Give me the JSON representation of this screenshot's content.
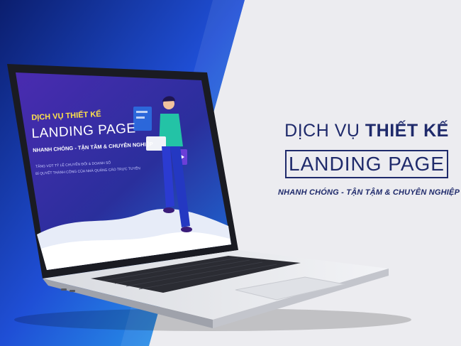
{
  "headline": {
    "line1_thin": "DỊCH VỤ ",
    "line1_bold": "THIẾT KẾ",
    "box_title": "LANDING PAGE",
    "subtitle": "NHANH CHÓNG - TẬN TẬM & CHUYÊN NGHIỆP"
  },
  "laptop_screen": {
    "line1": "DỊCH VỤ THIẾT KẾ",
    "line2": "LANDING PAGE",
    "line3": "NHANH CHÓNG - TẬN TÂM & CHUYÊN NGHIỆP",
    "line4": "TĂNG VỌT TỶ LỆ CHUYỂN ĐỔI & DOANH SỐ",
    "line5": "BÍ QUYẾT THÀNH CÔNG CỦA NHÀ QUẢNG CÁO TRỰC TUYẾN"
  },
  "colors": {
    "brand_navy": "#1f2a6b",
    "left_panel_blue": "#1e4fd0",
    "screen_purple": "#3a2aa8",
    "accent_yellow": "#ffe24a",
    "accent_teal": "#23c3a6"
  }
}
